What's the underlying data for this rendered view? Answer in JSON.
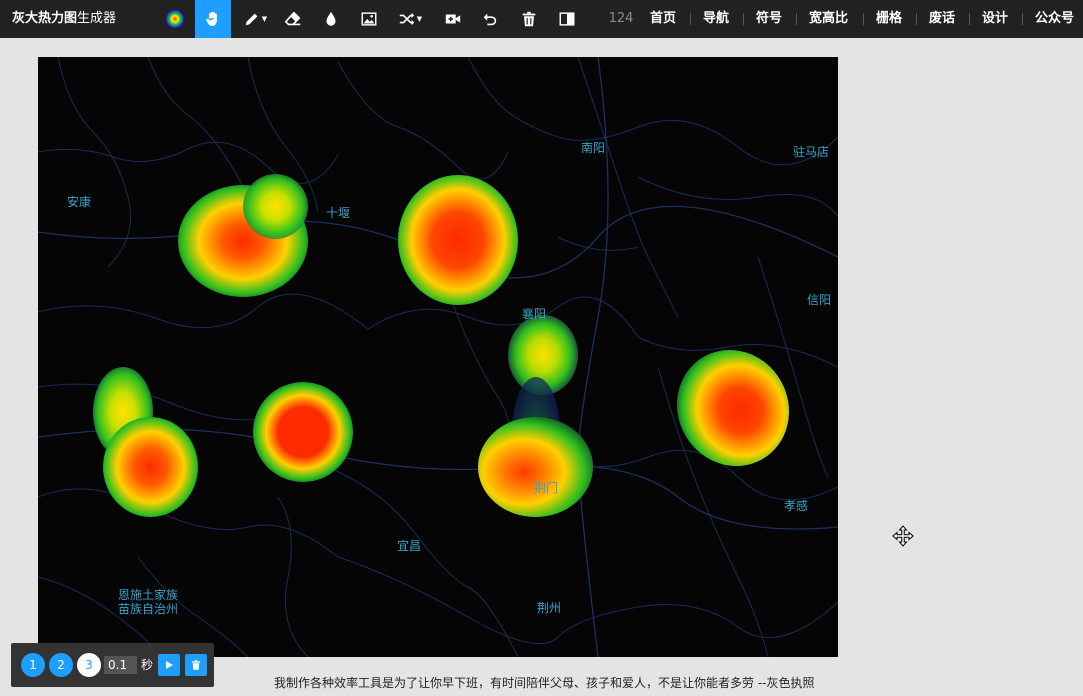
{
  "app": {
    "brand_bold": "灰大热力图",
    "brand_rest": "生成器"
  },
  "toolbar": {
    "icons": [
      "heatmap-gradient-icon",
      "hand-icon",
      "pen-icon",
      "eraser-icon",
      "drop-icon",
      "image-icon",
      "shuffle-icon",
      "add-video-icon",
      "undo-icon",
      "trash-icon",
      "split-view-icon"
    ],
    "active": "hand-icon",
    "count": "124",
    "nav": [
      "首页",
      "导航",
      "符号",
      "宽高比",
      "栅格",
      "废话",
      "设计",
      "公众号"
    ],
    "active_color": "#1e9fff"
  },
  "map": {
    "cities": {
      "nanyang": "南阳",
      "zhumadian": "驻马店",
      "ankang": "安康",
      "shiyan": "十堰",
      "xinyang": "信阳",
      "xiangyang": "襄阳",
      "jingmen": "荆门",
      "xiaogan": "孝感",
      "yichang": "宜昌",
      "enshi_1": "恩施土家族",
      "enshi_2": "苗族自治州",
      "jingzhou": "荆州"
    }
  },
  "player": {
    "frames": [
      "1",
      "2",
      "3"
    ],
    "selected_frame": "3",
    "speed": "0.1",
    "unit": "秒"
  },
  "footer": {
    "text": "我制作各种效率工具是为了让你早下班，有时间陪伴父母、孩子和爱人，不是让你能者多劳 --灰色执照"
  }
}
